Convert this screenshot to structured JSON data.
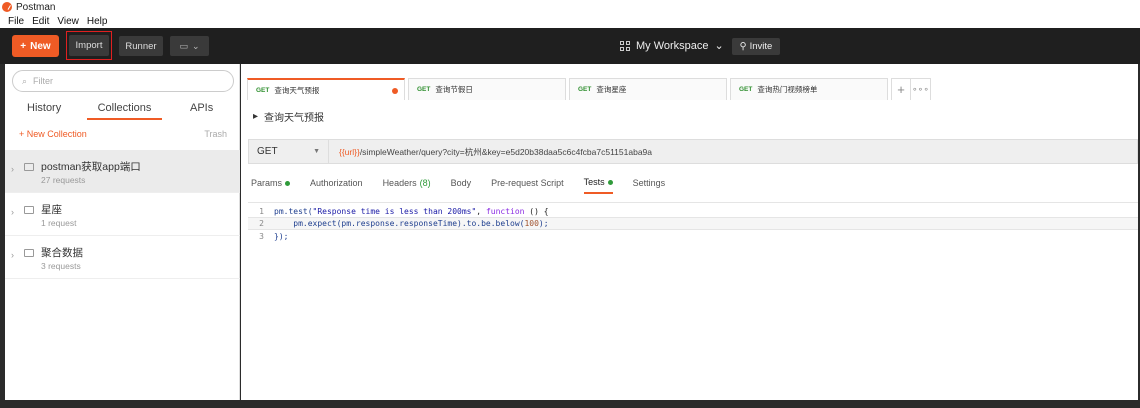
{
  "window": {
    "title": "Postman"
  },
  "menu": [
    "File",
    "Edit",
    "View",
    "Help"
  ],
  "toolbar": {
    "new_label": "New",
    "import_label": "Import",
    "runner_label": "Runner",
    "workspace_label": "My Workspace",
    "invite_label": "Invite"
  },
  "sidebar": {
    "search_placeholder": "Filter",
    "tabs": [
      "History",
      "Collections",
      "APIs"
    ],
    "active_tab": "Collections",
    "new_collection": "+ New Collection",
    "trash": "Trash",
    "collections": [
      {
        "name": "postman获取app端口",
        "count": "27 requests"
      },
      {
        "name": "星座",
        "count": "1 request"
      },
      {
        "name": "聚合数据",
        "count": "3 requests"
      }
    ]
  },
  "tabs": [
    {
      "method": "GET",
      "name": "查询天气预报"
    },
    {
      "method": "GET",
      "name": "查询节假日"
    },
    {
      "method": "GET",
      "name": "查询星座"
    },
    {
      "method": "GET",
      "name": "查询热门视频榜单"
    }
  ],
  "request": {
    "title": "查询天气预报",
    "method": "GET",
    "url_var": "{{url}}",
    "url_rest": "/simpleWeather/query?city=杭州&key=e5d20b38daa5c6c4fcba7c51151aba9a"
  },
  "request_tabs": {
    "params": "Params",
    "authorization": "Authorization",
    "headers": "Headers",
    "headers_count": "(8)",
    "body": "Body",
    "prerequest": "Pre-request Script",
    "tests": "Tests",
    "settings": "Settings"
  },
  "editor": {
    "line_numbers": [
      "1",
      "2",
      "3"
    ],
    "line1_a": "pm.test(",
    "line1_str": "\"Response time is less than 200ms\"",
    "line1_b": ", ",
    "line1_kw": "function",
    "line1_c": " () {",
    "line2_a": "    pm.expect(pm.response.responseTime).to.be.below(",
    "line2_num": "100",
    "line2_b": ");",
    "line3": "});"
  },
  "colors": {
    "accent": "#ef5b25",
    "toolbar": "#1f1f1f",
    "green": "#2f9a3a"
  }
}
